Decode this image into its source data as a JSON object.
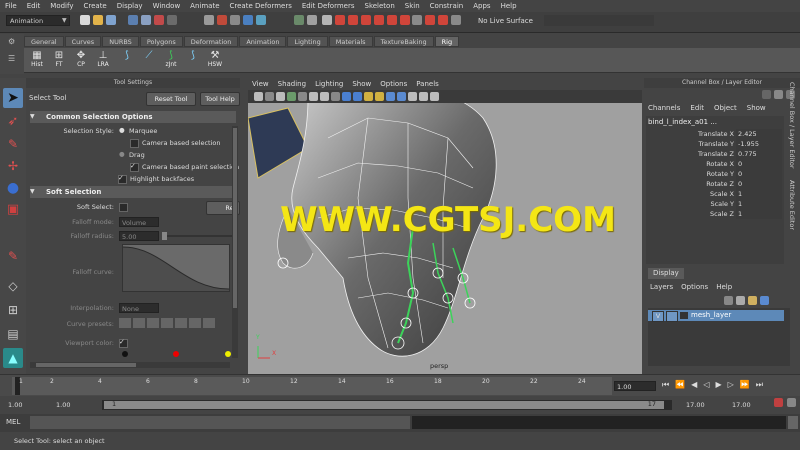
{
  "menu": [
    "File",
    "Edit",
    "Modify",
    "Create",
    "Display",
    "Window",
    "Animate",
    "Create Deformers",
    "Edit Deformers",
    "Skeleton",
    "Skin",
    "Constrain",
    "Apps",
    "Help"
  ],
  "status": {
    "mode": "Animation",
    "live_surface": "No Live Surface"
  },
  "shelf_tabs": [
    "General",
    "Curves",
    "NURBS",
    "Polygons",
    "Deformation",
    "Animation",
    "Lighting",
    "Materials",
    "TextureBaking",
    "Rig"
  ],
  "shelf_active": "Rig",
  "shelf_buttons": [
    "Hist",
    "FT",
    "CP",
    "LRA",
    "",
    "",
    "zJnt",
    "",
    "HSW"
  ],
  "tool_settings": {
    "header": "Tool Settings",
    "tool_name": "Select Tool",
    "reset_label": "Reset Tool",
    "help_label": "Tool Help",
    "common_section": "Common Selection Options",
    "selection_style_label": "Selection Style:",
    "marquee": "Marquee",
    "camera_based_selection": "Camera based selection",
    "drag": "Drag",
    "camera_based_paint": "Camera based paint selection",
    "highlight_backfaces": "Highlight backfaces",
    "soft_section": "Soft Selection",
    "soft_select_label": "Soft Select:",
    "reset_short": "Res",
    "falloff_mode_label": "Falloff mode:",
    "falloff_mode_value": "Volume",
    "falloff_radius_label": "Falloff radius:",
    "falloff_radius_value": "5.00",
    "falloff_curve_label": "Falloff curve:",
    "interpolation_label": "Interpolation:",
    "interpolation_value": "None",
    "curve_presets_label": "Curve presets:",
    "viewport_color_label": "Viewport color:"
  },
  "viewport": {
    "menu": [
      "View",
      "Shading",
      "Lighting",
      "Show",
      "Options",
      "Panels"
    ],
    "camera": "persp",
    "watermark": "WWW.CGTSJ.COM",
    "axis_y": "Y",
    "axis_x": "X"
  },
  "channel_box": {
    "title": "Channel Box / Layer Editor",
    "menu": [
      "Channels",
      "Edit",
      "Object",
      "Show"
    ],
    "object": "bind_l_index_a01 ...",
    "channels": [
      {
        "name": "Translate X",
        "value": "2.425"
      },
      {
        "name": "Translate Y",
        "value": "-1.955"
      },
      {
        "name": "Translate Z",
        "value": "0.775"
      },
      {
        "name": "Rotate X",
        "value": "0"
      },
      {
        "name": "Rotate Y",
        "value": "0"
      },
      {
        "name": "Rotate Z",
        "value": "0"
      },
      {
        "name": "Scale X",
        "value": "1"
      },
      {
        "name": "Scale Y",
        "value": "1"
      },
      {
        "name": "Scale Z",
        "value": "1"
      }
    ]
  },
  "side_tabs": [
    "Channel Box / Layer Editor",
    "Attribute Editor"
  ],
  "layer_editor": {
    "tab": "Display",
    "menu": [
      "Layers",
      "Options",
      "Help"
    ],
    "layer_vis": "V",
    "layer_name": "mesh_layer"
  },
  "timeline": {
    "ticks": [
      "1",
      "2",
      "4",
      "6",
      "8",
      "10",
      "12",
      "14",
      "16",
      "18",
      "20",
      "22",
      "24"
    ],
    "current": "1.00"
  },
  "range": {
    "start": "1.00",
    "start_inner": "1.00",
    "slider_start": "1",
    "slider_end": "17",
    "end_inner": "17.00",
    "end": "17.00"
  },
  "command": {
    "label": "MEL"
  },
  "help_line": "Select Tool: select an object",
  "colors": {
    "watermark": "#f4e615",
    "accent_blue": "#5d89b8",
    "joint_green": "#3cd35a"
  }
}
